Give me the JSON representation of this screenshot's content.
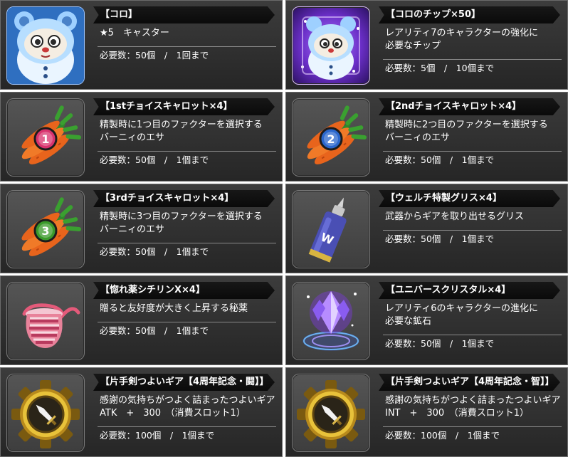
{
  "items": [
    {
      "icon": "koro-bear-character-icon",
      "title": "【コロ】",
      "description": [
        "★5　キャスター"
      ],
      "requirement": "必要数：50個　/　1回まで"
    },
    {
      "icon": "koro-chip-icon",
      "title": "【コロのチップ×50】",
      "description": [
        "レアリティ7のキャラクターの強化に",
        "必要なチップ"
      ],
      "requirement": "必要数：5個　/　10個まで"
    },
    {
      "icon": "carrot-bundle-1-icon",
      "title": "【1stチョイスキャロット×4】",
      "description": [
        "精製時に1つ目のファクターを選択する",
        "バーニィのエサ"
      ],
      "requirement": "必要数：50個　/　1個まで"
    },
    {
      "icon": "carrot-bundle-2-icon",
      "title": "【2ndチョイスキャロット×4】",
      "description": [
        "精製時に2つ目のファクターを選択する",
        "バーニィのエサ"
      ],
      "requirement": "必要数：50個　/　1個まで"
    },
    {
      "icon": "carrot-bundle-3-icon",
      "title": "【3rdチョイスキャロット×4】",
      "description": [
        "精製時に3つ目のファクターを選択する",
        "バーニィのエサ"
      ],
      "requirement": "必要数：50個　/　1個まで"
    },
    {
      "icon": "grease-bottle-icon",
      "title": "【ウェルチ特製グリス×4】",
      "description": [
        "武器からギアを取り出せるグリス"
      ],
      "requirement": "必要数：50個　/　1個まで"
    },
    {
      "icon": "love-potion-icon",
      "title": "【惚れ薬シチリンX×4】",
      "description": [
        "贈ると友好度が大きく上昇する秘薬"
      ],
      "requirement": "必要数：50個　/　1個まで"
    },
    {
      "icon": "universe-crystal-icon",
      "title": "【ユニバースクリスタル×4】",
      "description": [
        "レアリティ6のキャラクターの進化に",
        "必要な鉱石"
      ],
      "requirement": "必要数：50個　/　1個まで"
    },
    {
      "icon": "sword-gear-icon",
      "title": "【片手剣つよいギア【4周年記念・闘】】",
      "description": [
        "感謝の気持ちがつよく詰まったつよいギア",
        "ATK　+　300　（消費スロット1）"
      ],
      "requirement": "必要数：100個　/　1個まで"
    },
    {
      "icon": "sword-gear-icon",
      "title": "【片手剣つよいギア【4周年記念・智】】",
      "description": [
        "感謝の気持ちがつよく詰まったつよいギア",
        "INT　+　300　（消費スロット1）"
      ],
      "requirement": "必要数：100個　/　1個まで"
    }
  ]
}
